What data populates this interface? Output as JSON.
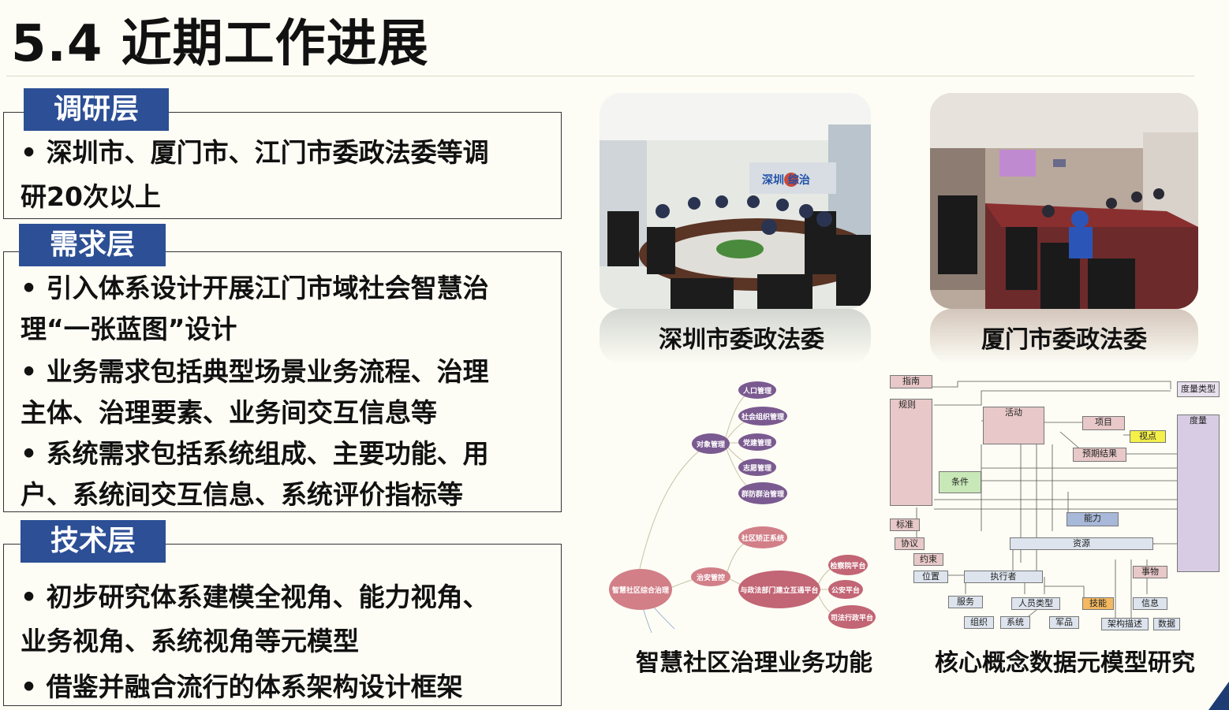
{
  "title": "5.4 近期工作进展",
  "sections": [
    {
      "tag": "调研层",
      "lines": [
        "• 深圳市、厦门市、江门市委政法委等调",
        "研20次以上"
      ]
    },
    {
      "tag": "需求层",
      "lines": [
        "• 引入体系设计开展江门市域社会智慧治",
        "理“一张蓝图”设计",
        "• 业务需求包括典型场景业务流程、治理",
        "主体、治理要素、业务间交互信息等",
        "• 系统需求包括系统组成、主要功能、用",
        "户、系统间交互信息、系统评价指标等"
      ]
    },
    {
      "tag": "技术层",
      "lines": [
        "• 初步研究体系建模全视角、能力视角、",
        "业务视角、系统视角等元模型",
        "• 借鉴并融合流行的体系架构设计框架"
      ]
    }
  ],
  "photos": [
    {
      "caption": "深圳市委政法委",
      "sign": "深圳  综治"
    },
    {
      "caption": "厦门市委政法委"
    }
  ],
  "mindmap": {
    "caption": "智慧社区治理业务功能",
    "root": "智慧社区综合治理",
    "n1": "对象管理",
    "n1_children": [
      "人口管理",
      "社会组织管理",
      "党建管理",
      "志愿管理",
      "群防群治管理"
    ],
    "n2": "治安管控",
    "n2_top": "社区矫正系统",
    "n2_mid": "与政法部门建立互通平台",
    "n2_mid_children": [
      "检察院平台",
      "公安平台",
      "司法行政平台"
    ]
  },
  "metamodel": {
    "caption": "核心概念数据元模型研究",
    "boxes": [
      "指南",
      "规则",
      "活动",
      "项目",
      "视点",
      "预期结果",
      "条件",
      "度量类型",
      "度量",
      "标准",
      "协议",
      "约束",
      "能力",
      "资源",
      "位置",
      "执行者",
      "事物",
      "服务",
      "人员类型",
      "技能",
      "信息",
      "组织",
      "系统",
      "军品",
      "架构描述",
      "数据"
    ]
  },
  "colors": {
    "tag_bg": "#2c4f95",
    "node_purple": "#7a5a90",
    "node_red": "#c97680",
    "corner": "#1f3b73"
  }
}
